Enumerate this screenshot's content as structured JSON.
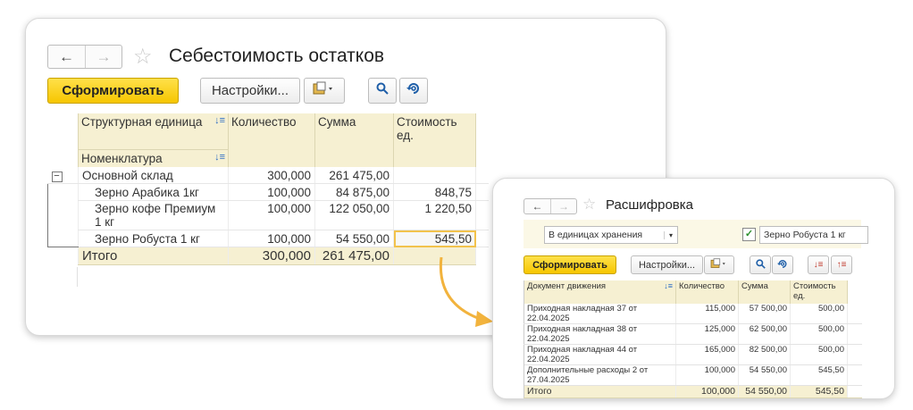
{
  "main": {
    "title": "Себестоимость остатков",
    "form_button": "Сформировать",
    "settings_button": "Настройки...",
    "columns": {
      "unit": "Структурная единица",
      "nomenclature": "Номенклатура",
      "qty": "Количество",
      "sum": "Сумма",
      "unit_cost": "Стоимость ед."
    },
    "rows": [
      {
        "name": "Основной склад",
        "qty": "300,000",
        "sum": "261 475,00",
        "cost": ""
      },
      {
        "name": "Зерно Арабика 1кг",
        "qty": "100,000",
        "sum": "84 875,00",
        "cost": "848,75"
      },
      {
        "name": "Зерно кофе Премиум 1 кг",
        "qty": "100,000",
        "sum": "122 050,00",
        "cost": "1 220,50"
      },
      {
        "name": "Зерно Робуста 1 кг",
        "qty": "100,000",
        "sum": "54 550,00",
        "cost": "545,50"
      }
    ],
    "total": {
      "label": "Итого",
      "qty": "300,000",
      "sum": "261 475,00"
    }
  },
  "detail": {
    "title": "Расшифровка",
    "units_select": "В единицах хранения",
    "item_field": "Зерно Робуста 1 кг",
    "form_button": "Сформировать",
    "settings_button": "Настройки...",
    "columns": {
      "doc": "Документ движения",
      "qty": "Количество",
      "sum": "Сумма",
      "unit_cost": "Стоимость ед."
    },
    "rows": [
      {
        "doc": "Приходная накладная 37 от 22.04.2025",
        "qty": "115,000",
        "sum": "57 500,00",
        "cost": "500,00"
      },
      {
        "doc": "Приходная накладная 38 от 22.04.2025",
        "qty": "125,000",
        "sum": "62 500,00",
        "cost": "500,00"
      },
      {
        "doc": "Приходная накладная 44 от 22.04.2025",
        "qty": "165,000",
        "sum": "82 500,00",
        "cost": "500,00"
      },
      {
        "doc": "Дополнительные расходы 2 от 27.04.2025",
        "qty": "100,000",
        "sum": "54 550,00",
        "cost": "545,50"
      }
    ],
    "total": {
      "label": "Итого",
      "qty": "100,000",
      "sum": "54 550,00",
      "cost": "545,50"
    }
  },
  "icons": {
    "back": "back-arrow-icon",
    "forward": "forward-arrow-icon",
    "star": "star-icon",
    "search": "search-icon",
    "refresh-search": "search-refresh-icon",
    "print": "print-options-icon",
    "collapse": "collapse-minus-icon",
    "check": "checkbox-checked-icon",
    "arrow": "callout-arrow-icon"
  },
  "colors": {
    "accent_yellow": "#f6c600",
    "header_bg": "#f6f0d2",
    "highlight": "#f2c24c",
    "link_blue": "#1f5fa8"
  }
}
